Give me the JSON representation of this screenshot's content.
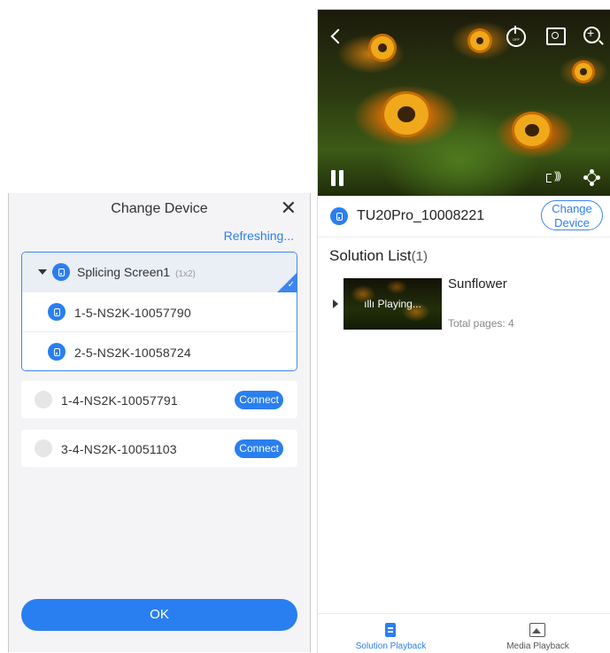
{
  "dialog": {
    "title": "Change Device",
    "refresh_label": "Refreshing...",
    "close_glyph": "✕",
    "group": {
      "name": "Splicing Screen1",
      "size": "(1x2)",
      "devices": [
        {
          "name": "1-5-NS2K-10057790"
        },
        {
          "name": "2-5-NS2K-10058724"
        }
      ]
    },
    "devices": [
      {
        "name": "1-4-NS2K-10057791",
        "action": "Connect"
      },
      {
        "name": "3-4-NS2K-10051103",
        "action": "Connect"
      }
    ],
    "ok_label": "OK"
  },
  "player": {
    "current_device": "TU20Pro_10008221",
    "change_device_label": "Change Device",
    "solution_list": {
      "heading": "Solution List",
      "count": "(1)",
      "items": [
        {
          "name": "Sunflower",
          "status": "ıllı Playing...",
          "pages": "Total pages: 4"
        }
      ]
    },
    "tabs": [
      {
        "label": "Solution Playback",
        "icon": "solution-doc-icon",
        "active": true
      },
      {
        "label": "Media Playback",
        "icon": "media-image-icon",
        "active": false
      }
    ],
    "power_icon_text": "OFF"
  },
  "colors": {
    "accent": "#2a7ff0",
    "panel_bg": "#f4f4f6"
  }
}
